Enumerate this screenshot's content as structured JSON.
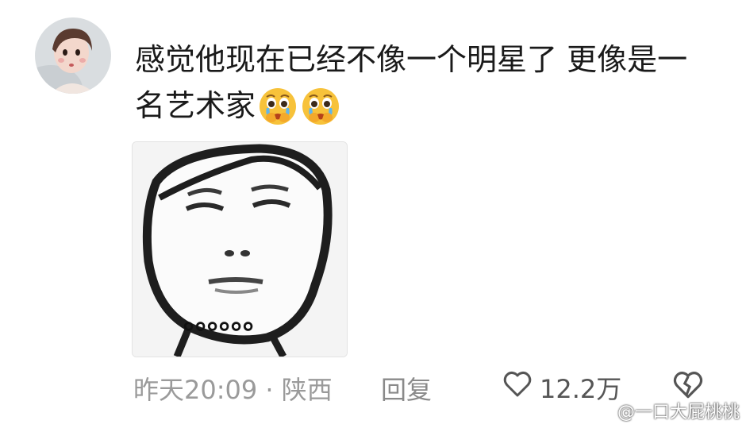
{
  "comment": {
    "text": "感觉他现在已经不像一个明星了 更像是一名艺术家",
    "emojis": [
      "crying-pleading-emoji",
      "crying-pleading-emoji"
    ]
  },
  "meme": {
    "dots": "。。。。。。"
  },
  "footer": {
    "meta": "昨天20:09 · 陕西",
    "reply_label": "回复",
    "like_count": "12.2万"
  },
  "watermark": {
    "text": "@一口大屁桃桃"
  },
  "icons": {
    "like": "heart-outline-icon",
    "dislike": "broken-heart-icon",
    "weibo": "weibo-logo-icon"
  }
}
